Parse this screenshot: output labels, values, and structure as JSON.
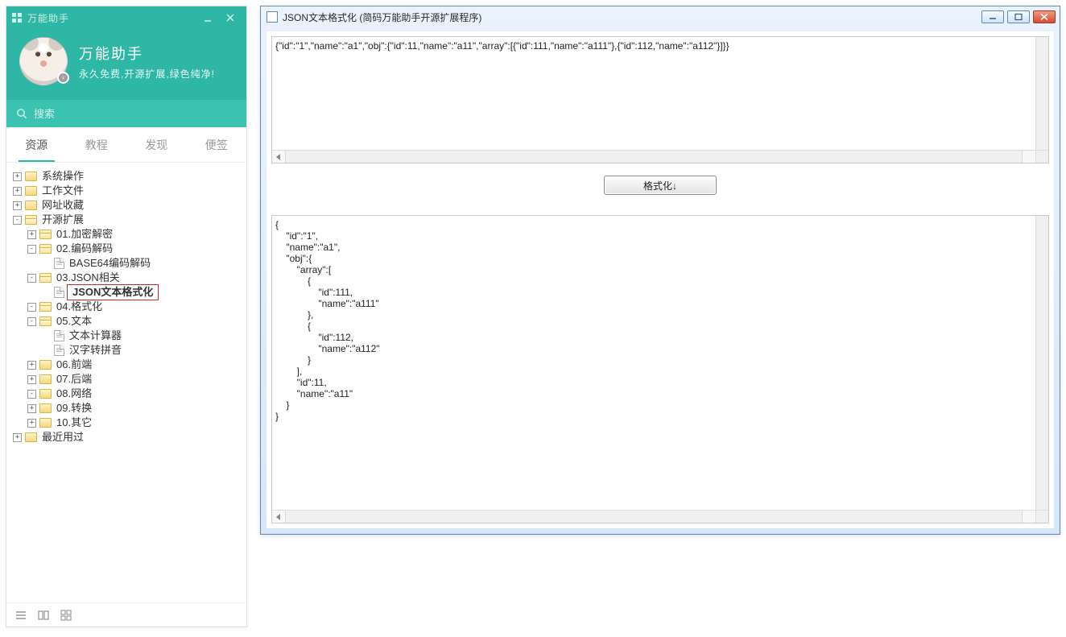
{
  "sidebar": {
    "appTitle": "万能助手",
    "heroTitle": "万能助手",
    "heroSubtitle": "永久免费,开源扩展,绿色纯净!",
    "searchPlaceholder": "搜索",
    "tabs": [
      "资源",
      "教程",
      "发现",
      "便签"
    ],
    "activeTab": 0,
    "tree": [
      {
        "label": "系统操作",
        "expander": "+",
        "icon": "folder"
      },
      {
        "label": "工作文件",
        "expander": "+",
        "icon": "folder"
      },
      {
        "label": "网址收藏",
        "expander": "+",
        "icon": "folder"
      },
      {
        "label": "开源扩展",
        "expander": "-",
        "icon": "folder-open",
        "children": [
          {
            "label": "01.加密解密",
            "expander": "+",
            "icon": "folder-open"
          },
          {
            "label": "02.编码解码",
            "expander": "-",
            "icon": "folder-open",
            "children": [
              {
                "label": "BASE64编码解码",
                "icon": "file"
              }
            ]
          },
          {
            "label": "03.JSON相关",
            "expander": "-",
            "icon": "folder-open",
            "children": [
              {
                "label": "JSON文本格式化",
                "icon": "file",
                "selected": true
              }
            ]
          },
          {
            "label": "04.格式化",
            "expander": "-",
            "icon": "folder-open"
          },
          {
            "label": "05.文本",
            "expander": "-",
            "icon": "folder-open",
            "children": [
              {
                "label": "文本计算器",
                "icon": "file"
              },
              {
                "label": "汉字转拼音",
                "icon": "file"
              }
            ]
          },
          {
            "label": "06.前端",
            "expander": "+",
            "icon": "folder"
          },
          {
            "label": "07.后端",
            "expander": "+",
            "icon": "folder"
          },
          {
            "label": "08.网络",
            "expander": "-",
            "icon": "folder"
          },
          {
            "label": "09.转换",
            "expander": "+",
            "icon": "folder"
          },
          {
            "label": "10.其它",
            "expander": "+",
            "icon": "folder"
          }
        ]
      },
      {
        "label": "最近用过",
        "expander": "+",
        "icon": "folder"
      }
    ]
  },
  "mainWindow": {
    "title": "JSON文本格式化 (简码万能助手开源扩展程序)",
    "inputText": "{\"id\":\"1\",\"name\":\"a1\",\"obj\":{\"id\":11,\"name\":\"a11\",\"array\":[{\"id\":111,\"name\":\"a111\"},{\"id\":112,\"name\":\"a112\"}]}}",
    "buttonLabel": "格式化↓",
    "outputText": "{\n    \"id\":\"1\",\n    \"name\":\"a1\",\n    \"obj\":{\n        \"array\":[\n            {\n                \"id\":111,\n                \"name\":\"a111\"\n            },\n            {\n                \"id\":112,\n                \"name\":\"a112\"\n            }\n        ],\n        \"id\":11,\n        \"name\":\"a11\"\n    }\n}"
  }
}
